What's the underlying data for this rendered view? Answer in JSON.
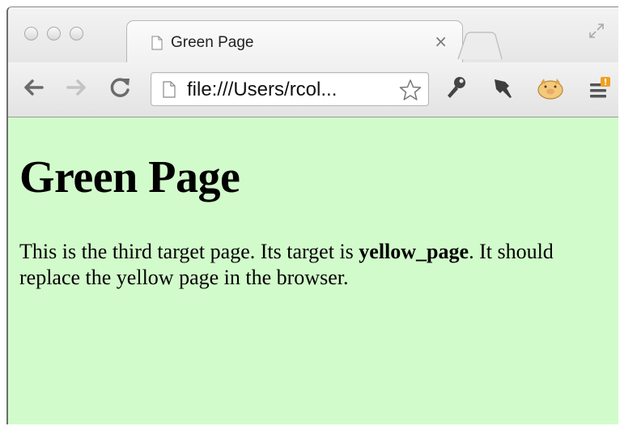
{
  "browser": {
    "tab": {
      "title": "Green Page",
      "close_label": "×"
    },
    "address_bar": {
      "value": "file:///Users/rcol..."
    },
    "icons": {
      "back": "back-arrow-icon",
      "forward": "forward-arrow-icon",
      "reload": "reload-icon",
      "page": "page-icon",
      "bookmark": "star-icon",
      "extension_1": "wrench-icon",
      "extension_2": "pin-icon",
      "extension_3": "pig-icon",
      "menu": "menu-icon"
    }
  },
  "page": {
    "heading": "Green Page",
    "paragraph": {
      "before": "This is the third target page. Its target is ",
      "bold": "yellow_page",
      "after": ". It should replace the yellow page in the browser."
    }
  },
  "colors": {
    "page_background": "#d2fbcb",
    "menu_badge": "#f0a020"
  }
}
